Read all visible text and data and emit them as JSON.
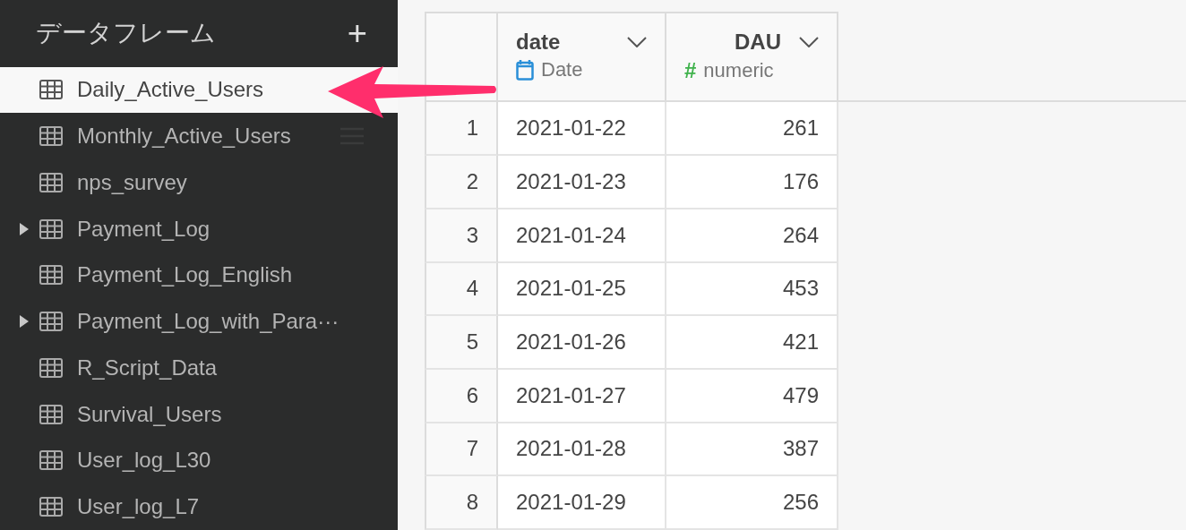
{
  "sidebar": {
    "title": "データフレーム",
    "add_label": "+",
    "items": [
      {
        "name": "Daily_Active_Users",
        "selected": true,
        "expandable": false,
        "menu": false
      },
      {
        "name": "Monthly_Active_Users",
        "selected": false,
        "expandable": false,
        "menu": true
      },
      {
        "name": "nps_survey",
        "selected": false,
        "expandable": false,
        "menu": false
      },
      {
        "name": "Payment_Log",
        "selected": false,
        "expandable": true,
        "menu": false
      },
      {
        "name": "Payment_Log_English",
        "selected": false,
        "expandable": false,
        "menu": false
      },
      {
        "name": "Payment_Log_with_Para···",
        "selected": false,
        "expandable": true,
        "menu": false
      },
      {
        "name": "R_Script_Data",
        "selected": false,
        "expandable": false,
        "menu": false
      },
      {
        "name": "Survival_Users",
        "selected": false,
        "expandable": false,
        "menu": false
      },
      {
        "name": "User_log_L30",
        "selected": false,
        "expandable": false,
        "menu": false
      },
      {
        "name": "User_log_L7",
        "selected": false,
        "expandable": false,
        "menu": false
      }
    ]
  },
  "table": {
    "columns": [
      {
        "name": "date",
        "type": "Date",
        "kind": "date"
      },
      {
        "name": "DAU",
        "type": "numeric",
        "kind": "numeric",
        "symbol": "#"
      }
    ],
    "rows": [
      {
        "index": "1",
        "cells": [
          "2021-01-22",
          "261"
        ]
      },
      {
        "index": "2",
        "cells": [
          "2021-01-23",
          "176"
        ]
      },
      {
        "index": "3",
        "cells": [
          "2021-01-24",
          "264"
        ]
      },
      {
        "index": "4",
        "cells": [
          "2021-01-25",
          "453"
        ]
      },
      {
        "index": "5",
        "cells": [
          "2021-01-26",
          "421"
        ]
      },
      {
        "index": "6",
        "cells": [
          "2021-01-27",
          "479"
        ]
      },
      {
        "index": "7",
        "cells": [
          "2021-01-28",
          "387"
        ]
      },
      {
        "index": "8",
        "cells": [
          "2021-01-29",
          "256"
        ]
      }
    ]
  }
}
